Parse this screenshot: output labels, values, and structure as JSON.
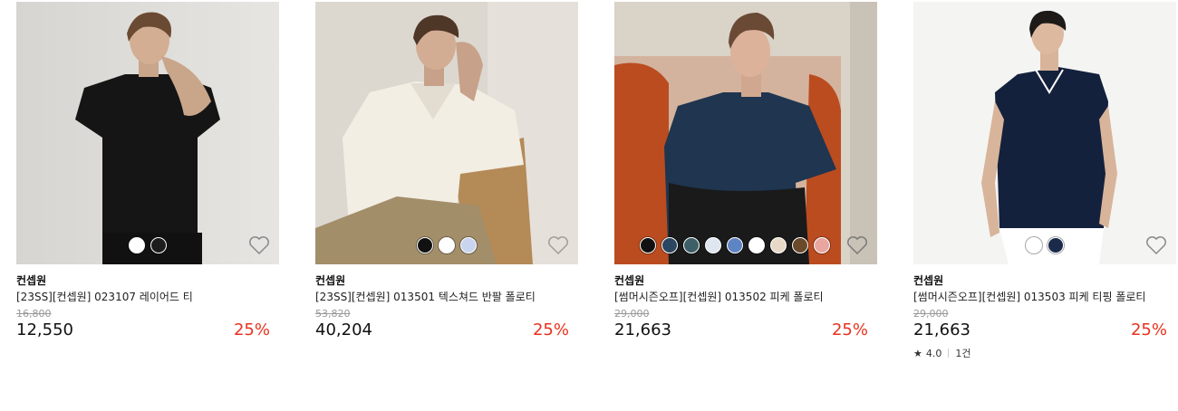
{
  "colors": {
    "discount": "#e8321e",
    "strikethrough": "#999999"
  },
  "products": [
    {
      "brand": "컨셉원",
      "name": "[23SS][컨셉원] 023107 레이어드 티",
      "original_price": "16,800",
      "price": "12,550",
      "discount": "25%",
      "swatches": [
        "#ffffff",
        "#1c1c1c"
      ]
    },
    {
      "brand": "컨셉원",
      "name": "[23SS][컨셉원] 013501 텍스쳐드 반팔 폴로티",
      "original_price": "53,820",
      "price": "40,204",
      "discount": "25%",
      "swatches": [
        "#111111",
        "#ffffff",
        "#c9d4ee"
      ]
    },
    {
      "brand": "컨셉원",
      "name": "[썸머시즌오프][컨셉원] 013502 피케 폴로티",
      "original_price": "29,000",
      "price": "21,663",
      "discount": "25%",
      "swatches": [
        "#111111",
        "#2a4660",
        "#3d5f67",
        "#dfe6ef",
        "#5f84c4",
        "#ffffff",
        "#e7d9c6",
        "#6b4a2c",
        "#e9a6a0"
      ]
    },
    {
      "brand": "컨셉원",
      "name": "[썸머시즌오프][컨셉원] 013503 피케 티핑 폴로티",
      "original_price": "29,000",
      "price": "21,663",
      "discount": "25%",
      "swatches": [
        "#ffffff",
        "#1a2a4a"
      ],
      "rating": "4.0",
      "review_count": "1건"
    }
  ]
}
